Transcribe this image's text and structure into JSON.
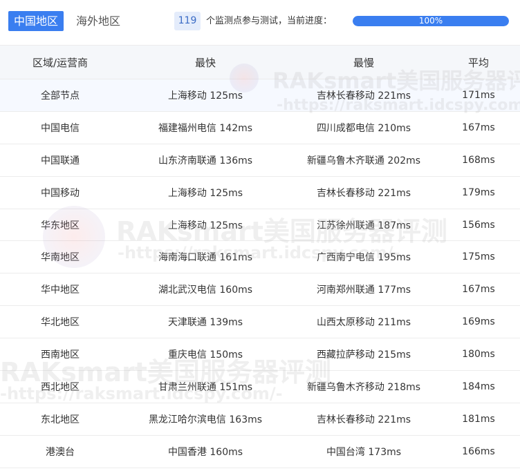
{
  "tabs": {
    "active_label": "中国地区",
    "inactive_label": "海外地区"
  },
  "monitor": {
    "count": "119",
    "text": "个监测点参与测试，当前进度：",
    "progress_label": "100%",
    "progress_value": 1.0
  },
  "watermark": {
    "line1": "RAKsmart美国服务器评测",
    "line2": "-https://raksmart.idcspy.com/-"
  },
  "table": {
    "headers": [
      "区域/运营商",
      "最快",
      "最慢",
      "平均"
    ],
    "rows": [
      [
        "全部节点",
        "上海移动 125ms",
        "吉林长春移动 221ms",
        "171ms"
      ],
      [
        "中国电信",
        "福建福州电信 142ms",
        "四川成都电信 210ms",
        "167ms"
      ],
      [
        "中国联通",
        "山东济南联通 136ms",
        "新疆乌鲁木齐联通 202ms",
        "168ms"
      ],
      [
        "中国移动",
        "上海移动 125ms",
        "吉林长春移动 221ms",
        "179ms"
      ],
      [
        "华东地区",
        "上海移动 125ms",
        "江苏徐州联通 187ms",
        "156ms"
      ],
      [
        "华南地区",
        "海南海口联通 161ms",
        "广西南宁电信 195ms",
        "175ms"
      ],
      [
        "华中地区",
        "湖北武汉电信 160ms",
        "河南郑州联通 177ms",
        "167ms"
      ],
      [
        "华北地区",
        "天津联通 139ms",
        "山西太原移动 211ms",
        "169ms"
      ],
      [
        "西南地区",
        "重庆电信 150ms",
        "西藏拉萨移动 215ms",
        "180ms"
      ],
      [
        "西北地区",
        "甘肃兰州联通 151ms",
        "新疆乌鲁木齐移动 218ms",
        "184ms"
      ],
      [
        "东北地区",
        "黑龙江哈尔滨电信 163ms",
        "吉林长春移动 221ms",
        "181ms"
      ],
      [
        "港澳台",
        "中国香港 160ms",
        "中国台湾 173ms",
        "166ms"
      ]
    ]
  }
}
